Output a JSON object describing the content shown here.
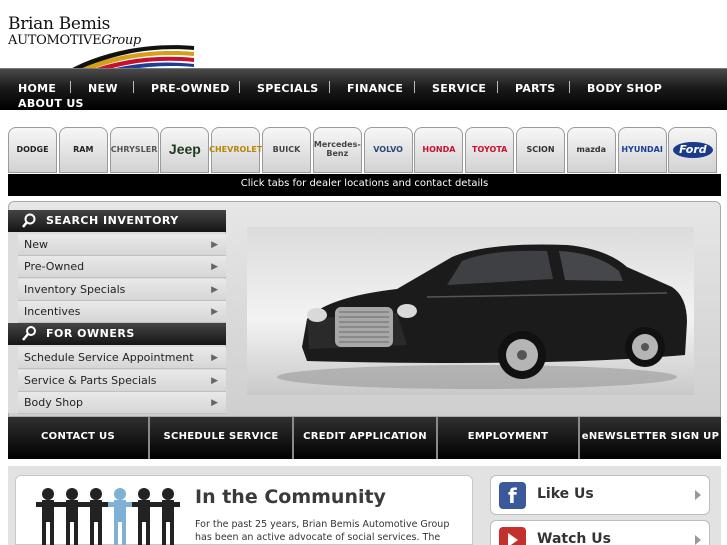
{
  "logo": {
    "line1": "Brian Bemis",
    "line2a": "AUTOMOTIVE",
    "line2b": "Group"
  },
  "nav": {
    "items": [
      "HOME",
      "NEW",
      "PRE-OWNED",
      "SPECIALS",
      "FINANCE",
      "SERVICE",
      "PARTS",
      "BODY SHOP",
      "ABOUT US"
    ]
  },
  "brands": [
    {
      "name": "DODGE",
      "color": "#222222"
    },
    {
      "name": "RAM",
      "color": "#222222"
    },
    {
      "name": "CHRYSLER",
      "color": "#555555"
    },
    {
      "name": "Jeep",
      "color": "#1d3a1d"
    },
    {
      "name": "CHEVROLET",
      "color": "#b8860b"
    },
    {
      "name": "BUICK",
      "color": "#444444"
    },
    {
      "name": "Mercedes-Benz",
      "color": "#444444"
    },
    {
      "name": "VOLVO",
      "color": "#2a4a7a"
    },
    {
      "name": "HONDA",
      "color": "#c8102e"
    },
    {
      "name": "TOYOTA",
      "color": "#c8102e"
    },
    {
      "name": "SCION",
      "color": "#333333"
    },
    {
      "name": "mazda",
      "color": "#333333"
    },
    {
      "name": "HYUNDAI",
      "color": "#1c3f94"
    },
    {
      "name": "Ford",
      "color": "#1a3a8a"
    }
  ],
  "infobar": "Click tabs for dealer locations and contact details",
  "sidebar": {
    "search_header": "SEARCH INVENTORY",
    "search_items": [
      "New",
      "Pre-Owned",
      "Inventory Specials",
      "Incentives"
    ],
    "owners_header": "FOR OWNERS",
    "owners_items": [
      "Schedule Service Appointment",
      "Service & Parts Specials",
      "Body Shop"
    ]
  },
  "buttons": [
    "CONTACT US",
    "SCHEDULE SERVICE",
    "CREDIT APPLICATION",
    "EMPLOYMENT",
    "eNEWSLETTER SIGN UP"
  ],
  "community": {
    "title": "In the Community",
    "text": "For the past 25 years, Brian Bemis Automotive Group has been an active advocate of social services. The"
  },
  "social": [
    {
      "label": "Like Us",
      "icon": "facebook-icon",
      "color": "#3b5998"
    },
    {
      "label": "Watch Us",
      "icon": "youtube-icon",
      "color": "#c4302b"
    }
  ]
}
